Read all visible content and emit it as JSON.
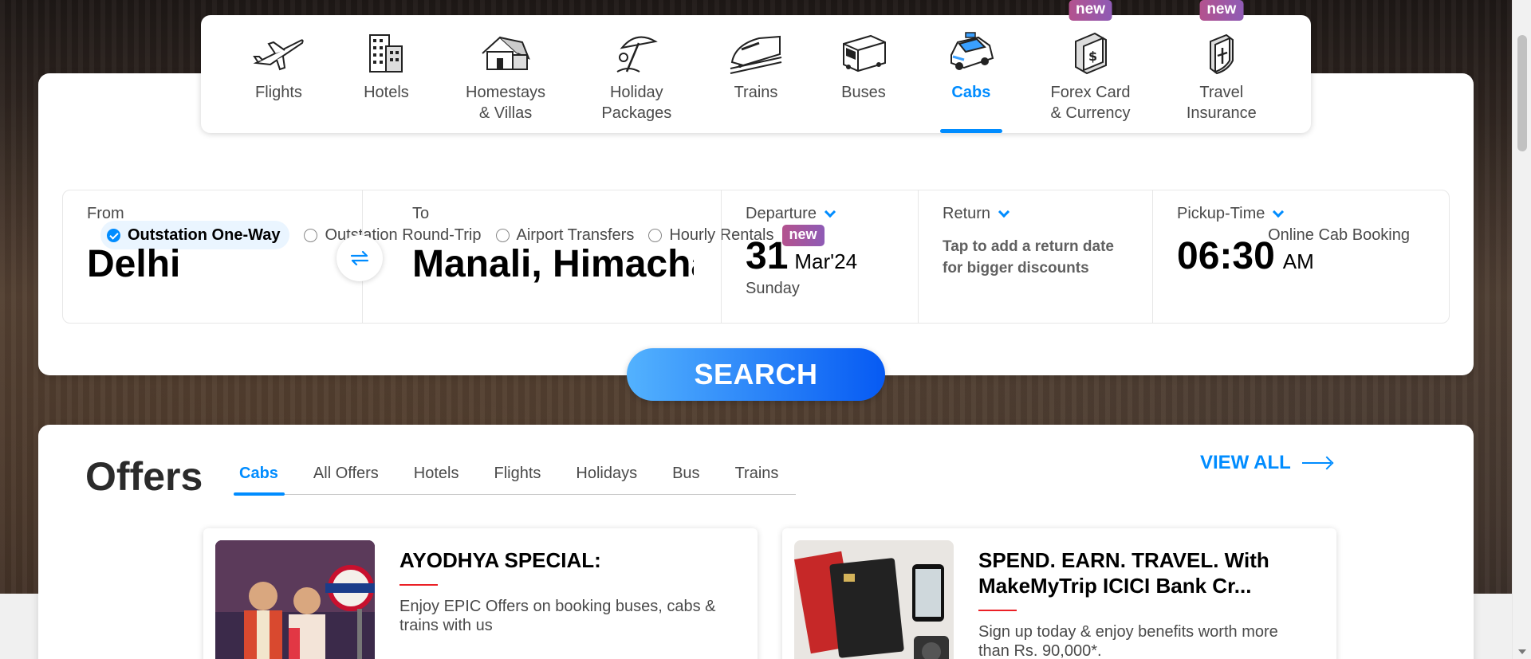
{
  "nav": {
    "items": [
      {
        "label": "Flights",
        "icon": "airplane-icon"
      },
      {
        "label": "Hotels",
        "icon": "hotel-building-icon"
      },
      {
        "label": "Homestays\n& Villas",
        "icon": "homestay-house-icon"
      },
      {
        "label": "Holiday\nPackages",
        "icon": "beach-umbrella-icon"
      },
      {
        "label": "Trains",
        "icon": "train-icon"
      },
      {
        "label": "Buses",
        "icon": "bus-icon"
      },
      {
        "label": "Cabs",
        "icon": "cab-car-icon"
      },
      {
        "label": "Forex Card\n& Currency",
        "icon": "forex-card-icon",
        "badge": "new"
      },
      {
        "label": "Travel\nInsurance",
        "icon": "insurance-shield-icon",
        "badge": "new"
      }
    ],
    "active": "Cabs"
  },
  "trip_types": {
    "one_way": "Outstation One-Way",
    "round_trip": "Outstation Round-Trip",
    "airport": "Airport Transfers",
    "hourly": "Hourly Rentals",
    "hourly_badge": "new",
    "selected": "Outstation One-Way"
  },
  "online_booking": "Online Cab Booking",
  "fields": {
    "from_label": "From",
    "from_value": "Delhi",
    "to_label": "To",
    "to_value": "Manali, Himachal Pradesh",
    "departure_label": "Departure",
    "departure_day": "31",
    "departure_month": "Mar'24",
    "departure_weekday": "Sunday",
    "return_label": "Return",
    "return_hint": "Tap to add a return date for bigger discounts",
    "pickup_label": "Pickup-Time",
    "pickup_time": "06:30",
    "pickup_ampm": "AM"
  },
  "search_label": "SEARCH",
  "offers": {
    "title": "Offers",
    "tabs": [
      "Cabs",
      "All Offers",
      "Hotels",
      "Flights",
      "Holidays",
      "Bus",
      "Trains"
    ],
    "active_tab": "Cabs",
    "view_all": "VIEW ALL",
    "cards": [
      {
        "heading": "AYODHYA SPECIAL:",
        "desc": "Enjoy EPIC Offers on booking buses, cabs & trains with us"
      },
      {
        "heading": "SPEND. EARN. TRAVEL. With MakeMyTrip ICICI Bank Cr...",
        "desc": "Sign up today & enjoy benefits worth more than Rs. 90,000*."
      }
    ]
  },
  "colors": {
    "accent": "#008cff",
    "badge_gradient_start": "#b4528e",
    "badge_gradient_end": "#8e5bb5",
    "search_gradient_start": "#53b2fe",
    "search_gradient_end": "#065af3",
    "offer_rule": "#eb2026"
  }
}
